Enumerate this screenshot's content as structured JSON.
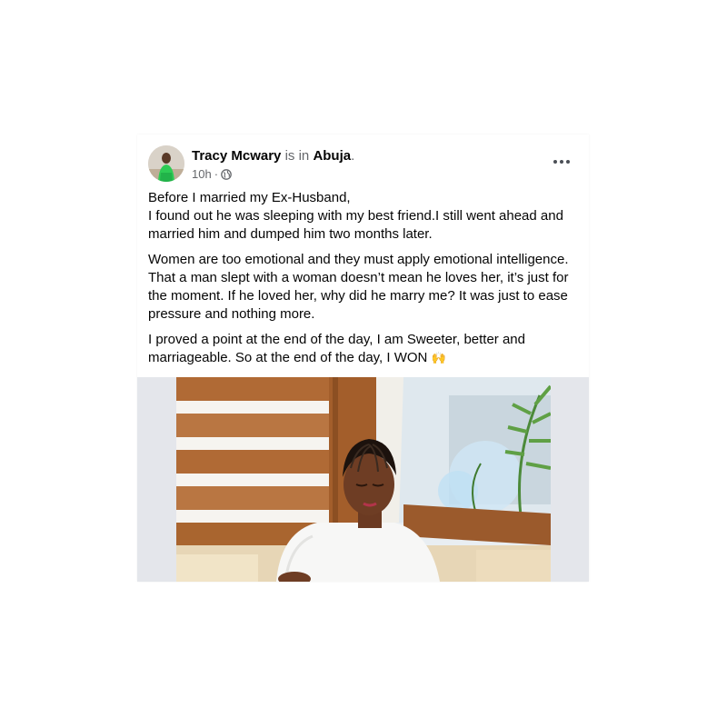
{
  "post": {
    "author": "Tracy Mcwary",
    "is_in": "is in",
    "location": "Abuja",
    "location_dot": ".",
    "time": "10h",
    "separator": "·",
    "privacy_icon": "globe-icon",
    "more_icon": "more-options-icon",
    "paragraphs": [
      {
        "lines": [
          "Before I married my Ex-Husband,",
          "I found out he was sleeping with my best friend.I still went ahead and",
          "married him and dumped him two months later."
        ]
      },
      {
        "lines": [
          "Women are too emotional and they must apply emotional intelligence.",
          "That a man slept with a woman doesn’t mean he loves her, it’s just for",
          "the moment. If he loved her, why did he marry me? It was just to ease",
          "pressure and nothing more."
        ]
      },
      {
        "lines": [
          "I proved a point at the end of the day, I am Sweeter, better and",
          "marriageable. So at the end of the day, I WON"
        ],
        "emoji": "🙌"
      }
    ]
  },
  "colors": {
    "text": "#050505",
    "secondary": "#65676b",
    "photo_background": "#e4e6eb"
  }
}
